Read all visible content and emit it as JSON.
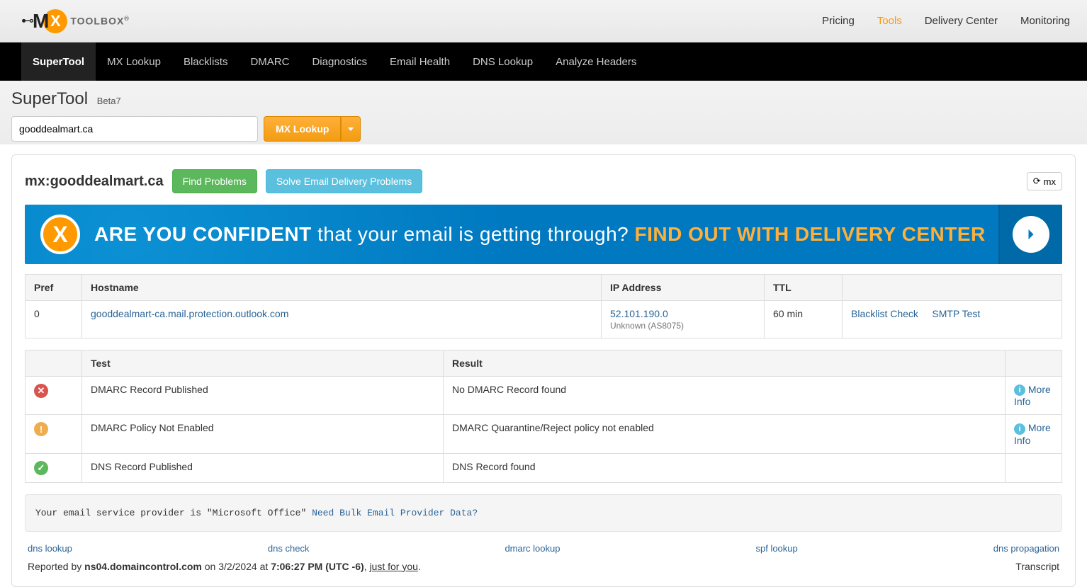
{
  "brand": {
    "mark": "M",
    "x": "X",
    "text": "TOOLBOX",
    "reg": "®"
  },
  "topnav": {
    "pricing": "Pricing",
    "tools": "Tools",
    "delivery": "Delivery Center",
    "monitoring": "Monitoring"
  },
  "blacknav": {
    "supertool": "SuperTool",
    "mxlookup": "MX Lookup",
    "blacklists": "Blacklists",
    "dmarc": "DMARC",
    "diagnostics": "Diagnostics",
    "emailhealth": "Email Health",
    "dnslookup": "DNS Lookup",
    "analyzeheaders": "Analyze Headers"
  },
  "page": {
    "title": "SuperTool",
    "beta": "Beta7",
    "search_value": "gooddealmart.ca",
    "mx_button": "MX Lookup"
  },
  "query": {
    "label": "mx:gooddealmart.ca",
    "find_problems": "Find Problems",
    "solve_problems": "Solve Email Delivery Problems",
    "refresh": "mx"
  },
  "banner": {
    "prefix_bold": "ARE YOU CONFIDENT",
    "middle": " that your email is getting through? ",
    "cta": "FIND OUT WITH DELIVERY CENTER"
  },
  "mxtable": {
    "headers": {
      "pref": "Pref",
      "hostname": "Hostname",
      "ip": "IP Address",
      "ttl": "TTL",
      "actions": ""
    },
    "row": {
      "pref": "0",
      "hostname": "gooddealmart-ca.mail.protection.outlook.com",
      "ip": "52.101.190.0",
      "ipnote": "Unknown (AS8075)",
      "ttl": "60 min",
      "blacklist": "Blacklist Check",
      "smtp": "SMTP Test"
    }
  },
  "teststable": {
    "headers": {
      "icon": "",
      "test": "Test",
      "result": "Result",
      "action": ""
    },
    "rows": [
      {
        "status": "error",
        "test": "DMARC Record Published",
        "result": "No DMARC Record found",
        "more": "More Info"
      },
      {
        "status": "warn",
        "test": "DMARC Policy Not Enabled",
        "result": "DMARC Quarantine/Reject policy not enabled",
        "more": "More Info"
      },
      {
        "status": "ok",
        "test": "DNS Record Published",
        "result": "DNS Record found",
        "more": ""
      }
    ],
    "more_label": "More Info"
  },
  "provider": {
    "text": "Your email service provider is \"Microsoft Office\"  ",
    "link": "Need Bulk Email Provider Data?"
  },
  "bottomlinks": {
    "dns_lookup": "dns lookup",
    "dns_check": "dns check",
    "dmarc_lookup": "dmarc lookup",
    "spf_lookup": "spf lookup",
    "dns_propagation": "dns propagation"
  },
  "report": {
    "prefix": "Reported by ",
    "ns": "ns04.domaincontrol.com",
    "on": " on 3/2/2024 at ",
    "time": "7:06:27 PM (UTC -6)",
    "suffix": ", ",
    "just": "just for you",
    "period": ".",
    "transcript": "Transcript"
  }
}
